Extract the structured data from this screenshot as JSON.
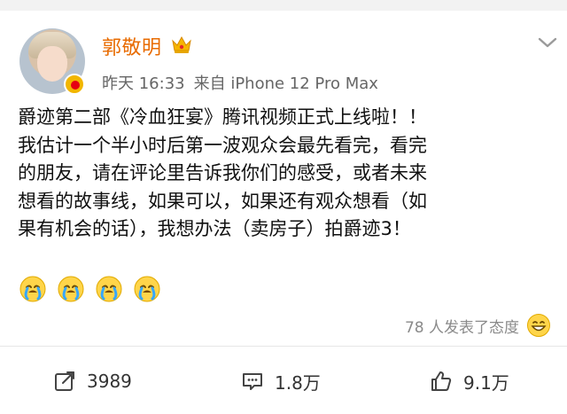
{
  "post": {
    "author": {
      "name": "郭敬明",
      "badge_icon": "crown-icon",
      "verified_icon": "verified-badge-icon"
    },
    "meta": {
      "time": "昨天 16:33",
      "source": "来自 iPhone 12 Pro Max"
    },
    "text_lines": [
      "爵迹第二部《冷血狂宴》腾讯视频正式上线啦！！",
      "我估计一个半小时后第一波观众会最先看完，看完",
      "的朋友，请在评论里告诉我你们的感受，或者未来",
      "想看的故事线，如果可以，如果还有观众想看（如",
      "果有机会的话），我想办法（卖房子）拍爵迹3！"
    ],
    "emoji_line": [
      "cry-emoji",
      "cry-emoji",
      "cry-emoji",
      "cry-emoji"
    ],
    "reaction_summary": "78 人发表了态度",
    "actions": {
      "share_count": "3989",
      "comment_count": "1.8万",
      "like_count": "9.1万"
    }
  },
  "colors": {
    "username": "#e86b00",
    "meta_text": "#666666",
    "background": "#ffffff",
    "top_band": "#f2f2f2",
    "divider": "#e6e6e6"
  }
}
